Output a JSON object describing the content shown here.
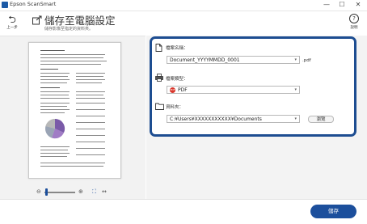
{
  "window": {
    "title": "Epson ScanSmart",
    "minimize": "—",
    "maximize": "☐",
    "close": "✕"
  },
  "header": {
    "back_label": "上一步",
    "title": "儲存至電腦設定",
    "subtitle": "儲存影像至指定的資料夾。",
    "help_label": "說明"
  },
  "form": {
    "filename_label": "檔案名稱：",
    "filename_value": "Document_YYYYMMDD_0001",
    "filename_ext": ".pdf",
    "filetype_label": "檔案類型：",
    "filetype_value": "PDF",
    "filetype_badge": "PDF",
    "folder_label": "資料夾：",
    "folder_value": "C:¥Users¥XXXXXXXXXXX¥Documents",
    "browse_label": "瀏覽"
  },
  "zoom": {
    "out": "⊖",
    "in": "⊕",
    "fit": "⛶",
    "swap": "↔"
  },
  "footer": {
    "save_label": "儲存"
  },
  "colors": {
    "accent": "#1c4f9c",
    "frame": "#1d4d91",
    "pdf_badge": "#d9362b",
    "panel_bg": "#f2f2f2"
  },
  "icons": {
    "back": "back-arrow-icon",
    "header": "save-to-computer-icon",
    "help": "help-icon",
    "filename": "file-icon",
    "filetype": "printer-icon",
    "folder": "folder-icon"
  }
}
